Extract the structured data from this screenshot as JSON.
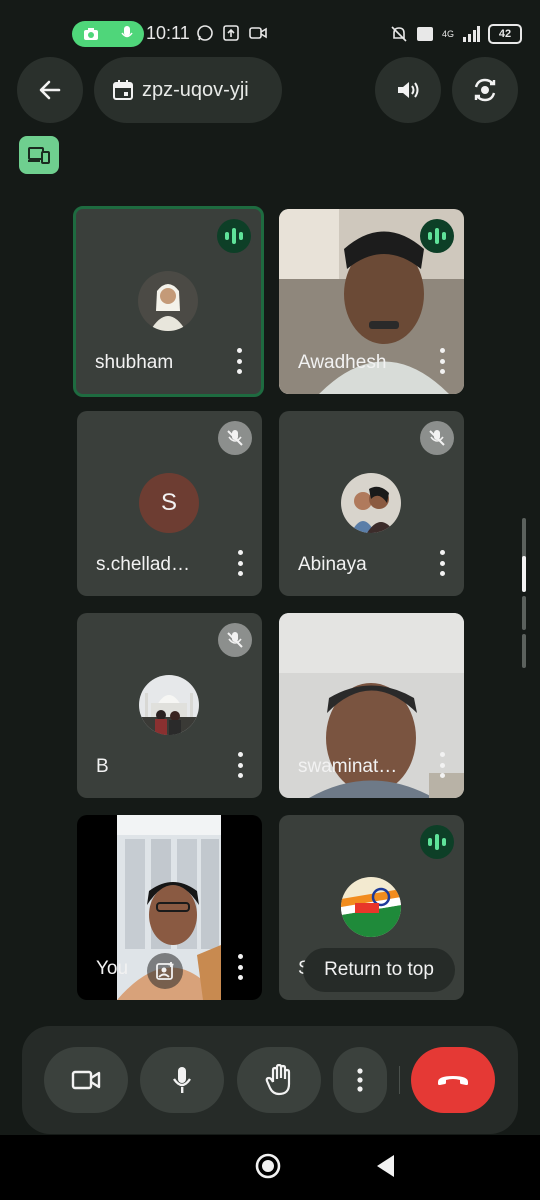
{
  "status_bar": {
    "time": "10:11",
    "battery": "42",
    "network": "4G"
  },
  "meeting": {
    "code": "zpz-uqov-yji"
  },
  "tiles": [
    {
      "name": "shubham",
      "state": "speaking",
      "active": true
    },
    {
      "name": "Awadhesh",
      "state": "speaking"
    },
    {
      "name": "s.chellad…",
      "state": "muted",
      "initial": "S"
    },
    {
      "name": "Abinaya",
      "state": "muted"
    },
    {
      "name": "B",
      "state": "muted"
    },
    {
      "name": "swaminat…",
      "state": "video"
    },
    {
      "name": "You",
      "state": "self-video"
    },
    {
      "name": "Sa",
      "state": "speaking"
    }
  ],
  "return_to_top": "Return to top",
  "colors": {
    "background": "#151a17",
    "tile": "#3a3f3b",
    "speak_badge": "#0d3f27",
    "end_call": "#e53935",
    "cast": "#6fcf8f"
  }
}
